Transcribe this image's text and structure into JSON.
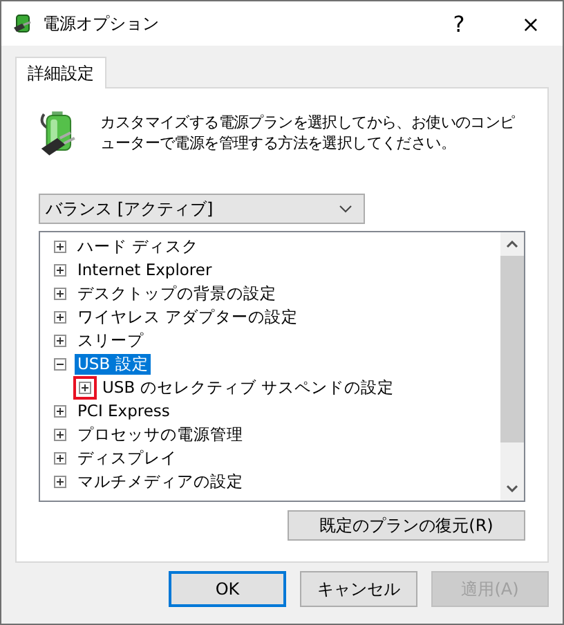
{
  "window": {
    "title": "電源オプション",
    "help": "?",
    "close": "×"
  },
  "tabs": [
    {
      "label": "詳細設定",
      "selected": true
    }
  ],
  "description": "カスタマイズする電源プランを選択してから、お使いのコンピューターで電源を管理する方法を選択してください。",
  "plan_dropdown": {
    "value": "バランス [アクティブ]"
  },
  "tree": {
    "items": [
      {
        "label": "ハード ディスク",
        "expanded": false,
        "selected": false
      },
      {
        "label": "Internet Explorer",
        "expanded": false,
        "selected": false
      },
      {
        "label": "デスクトップの背景の設定",
        "expanded": false,
        "selected": false
      },
      {
        "label": "ワイヤレス アダプターの設定",
        "expanded": false,
        "selected": false
      },
      {
        "label": "スリープ",
        "expanded": false,
        "selected": false
      },
      {
        "label": "USB 設定",
        "expanded": true,
        "selected": true,
        "children": [
          {
            "label": "USB のセレクティブ サスペンドの設定",
            "expanded": false,
            "selected": false,
            "highlighted": true
          }
        ]
      },
      {
        "label": "PCI Express",
        "expanded": false,
        "selected": false
      },
      {
        "label": "プロセッサの電源管理",
        "expanded": false,
        "selected": false
      },
      {
        "label": "ディスプレイ",
        "expanded": false,
        "selected": false
      },
      {
        "label": "マルチメディアの設定",
        "expanded": false,
        "selected": false
      }
    ]
  },
  "restore_button": "既定のプランの復元(R)",
  "buttons": [
    {
      "label": "OK",
      "kind": "default",
      "disabled": false
    },
    {
      "label": "キャンセル",
      "kind": "normal",
      "disabled": false
    },
    {
      "label": "適用(A)",
      "kind": "normal",
      "disabled": true
    }
  ]
}
